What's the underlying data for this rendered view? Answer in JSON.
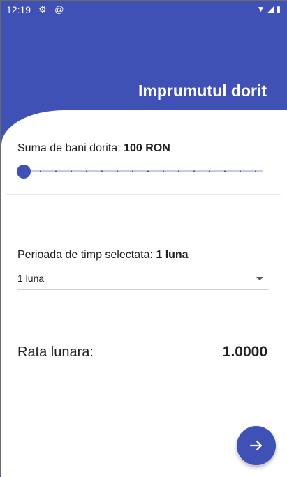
{
  "status_bar": {
    "time": "12:19",
    "left_icons": [
      "gear-icon",
      "at-icon"
    ],
    "right_icons": [
      "wifi-icon",
      "signal-icon",
      "battery-icon"
    ]
  },
  "header": {
    "title": "Imprumutul dorit"
  },
  "amount": {
    "label": "Suma de bani dorita: ",
    "value": "100 RON",
    "slider_fraction": 0.0
  },
  "period": {
    "label": "Perioada de timp selectata: ",
    "value": "1 luna",
    "dropdown_selected": "1 luna"
  },
  "rate": {
    "label": "Rata lunara:",
    "value": "1.0000"
  },
  "colors": {
    "primary": "#3f51b5",
    "slider_track": "#c5cae9"
  },
  "fab_icon": "arrow-right-icon"
}
